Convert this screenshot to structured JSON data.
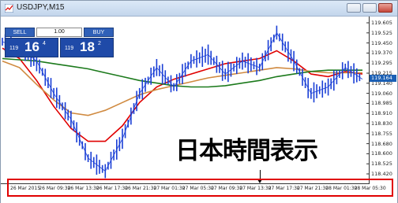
{
  "window": {
    "title": "USDJPY,M15",
    "icon": "chart-icon"
  },
  "trade_panel": {
    "sell_label": "SELL",
    "buy_label": "BUY",
    "lot_value": "1.00",
    "sell_quote": {
      "base": "119",
      "big": "16",
      "sup": "4"
    },
    "buy_quote": {
      "base": "119",
      "big": "18",
      "sup": "2"
    }
  },
  "price_marker": "119.164",
  "annotation": "日本時間表示",
  "chart_data": {
    "type": "line",
    "title": "USDJPY,M15",
    "ylim": [
      118.38,
      119.62
    ],
    "y_ticks": [
      "119.605",
      "119.525",
      "119.450",
      "119.370",
      "119.295",
      "119.215",
      "119.140",
      "119.060",
      "118.985",
      "118.910",
      "118.830",
      "118.755",
      "118.680",
      "118.600",
      "118.525",
      "118.420"
    ],
    "x_ticks": [
      "26 Mar 2015",
      "26 Mar 09:30",
      "26 Mar 13:30",
      "26 Mar 17:30",
      "26 Mar 21:30",
      "27 Mar 01:30",
      "27 Mar 05:30",
      "27 Mar 09:30",
      "27 Mar 13:30",
      "27 Mar 17:30",
      "27 Mar 21:30",
      "28 Mar 01:30",
      "28 Mar 05:30"
    ],
    "series": [
      {
        "color": "#e00000",
        "values": [
          119.4,
          119.32,
          119.15,
          118.95,
          118.78,
          118.68,
          118.68,
          118.8,
          118.98,
          119.1,
          119.16,
          119.2,
          119.24,
          119.28,
          119.3,
          119.32,
          119.38,
          119.3,
          119.2,
          119.18,
          119.22,
          119.2
        ]
      },
      {
        "color": "#d08a40",
        "values": [
          119.3,
          119.25,
          119.12,
          119.0,
          118.9,
          118.88,
          118.92,
          118.98,
          119.04,
          119.08,
          119.11,
          119.14,
          119.17,
          119.19,
          119.21,
          119.23,
          119.25,
          119.24,
          119.22,
          119.21,
          119.21,
          119.21
        ]
      },
      {
        "color": "#1c7a1c",
        "values": [
          119.32,
          119.31,
          119.3,
          119.28,
          119.26,
          119.24,
          119.21,
          119.18,
          119.15,
          119.13,
          119.11,
          119.1,
          119.1,
          119.11,
          119.13,
          119.15,
          119.18,
          119.2,
          119.22,
          119.23,
          119.23,
          119.23
        ]
      },
      {
        "color": "#1a3fd6",
        "values": [
          119.45,
          119.4,
          119.3,
          119.05,
          118.85,
          118.55,
          118.45,
          118.7,
          119.05,
          119.25,
          119.1,
          119.3,
          119.35,
          119.2,
          119.3,
          119.25,
          119.52,
          119.3,
          119.05,
          119.1,
          119.25,
          119.16
        ]
      }
    ]
  }
}
